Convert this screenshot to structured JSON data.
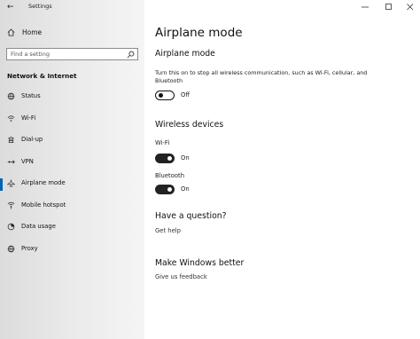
{
  "app": {
    "title": "Settings",
    "back_glyph": "←"
  },
  "window_controls": [
    "minimize-icon",
    "maximize-icon",
    "close-icon"
  ],
  "sidebar": {
    "home_label": "Home",
    "search_placeholder": "Find a setting",
    "section_title": "Network & Internet",
    "items": [
      {
        "label": "Status",
        "icon": "status-globe-icon"
      },
      {
        "label": "Wi-Fi",
        "icon": "wifi-icon"
      },
      {
        "label": "Dial-up",
        "icon": "dialup-icon"
      },
      {
        "label": "VPN",
        "icon": "vpn-icon"
      },
      {
        "label": "Airplane mode",
        "icon": "airplane-icon",
        "active": true
      },
      {
        "label": "Mobile hotspot",
        "icon": "hotspot-icon"
      },
      {
        "label": "Data usage",
        "icon": "data-usage-icon"
      },
      {
        "label": "Proxy",
        "icon": "proxy-globe-icon"
      }
    ]
  },
  "content": {
    "title": "Airplane mode",
    "airplane": {
      "heading": "Airplane mode",
      "description": "Turn this on to stop all wireless communication, such as Wi-Fi, cellular, and Bluetooth",
      "state": "Off"
    },
    "wireless": {
      "heading": "Wireless devices",
      "wifi_label": "Wi-Fi",
      "wifi_state": "On",
      "bluetooth_label": "Bluetooth",
      "bluetooth_state": "On"
    },
    "question": {
      "heading": "Have a question?",
      "link": "Get help"
    },
    "better": {
      "heading": "Make Windows better",
      "link": "Give us feedback"
    }
  },
  "colors": {
    "accent": "#0063b1",
    "toggle_on": "#222222"
  }
}
